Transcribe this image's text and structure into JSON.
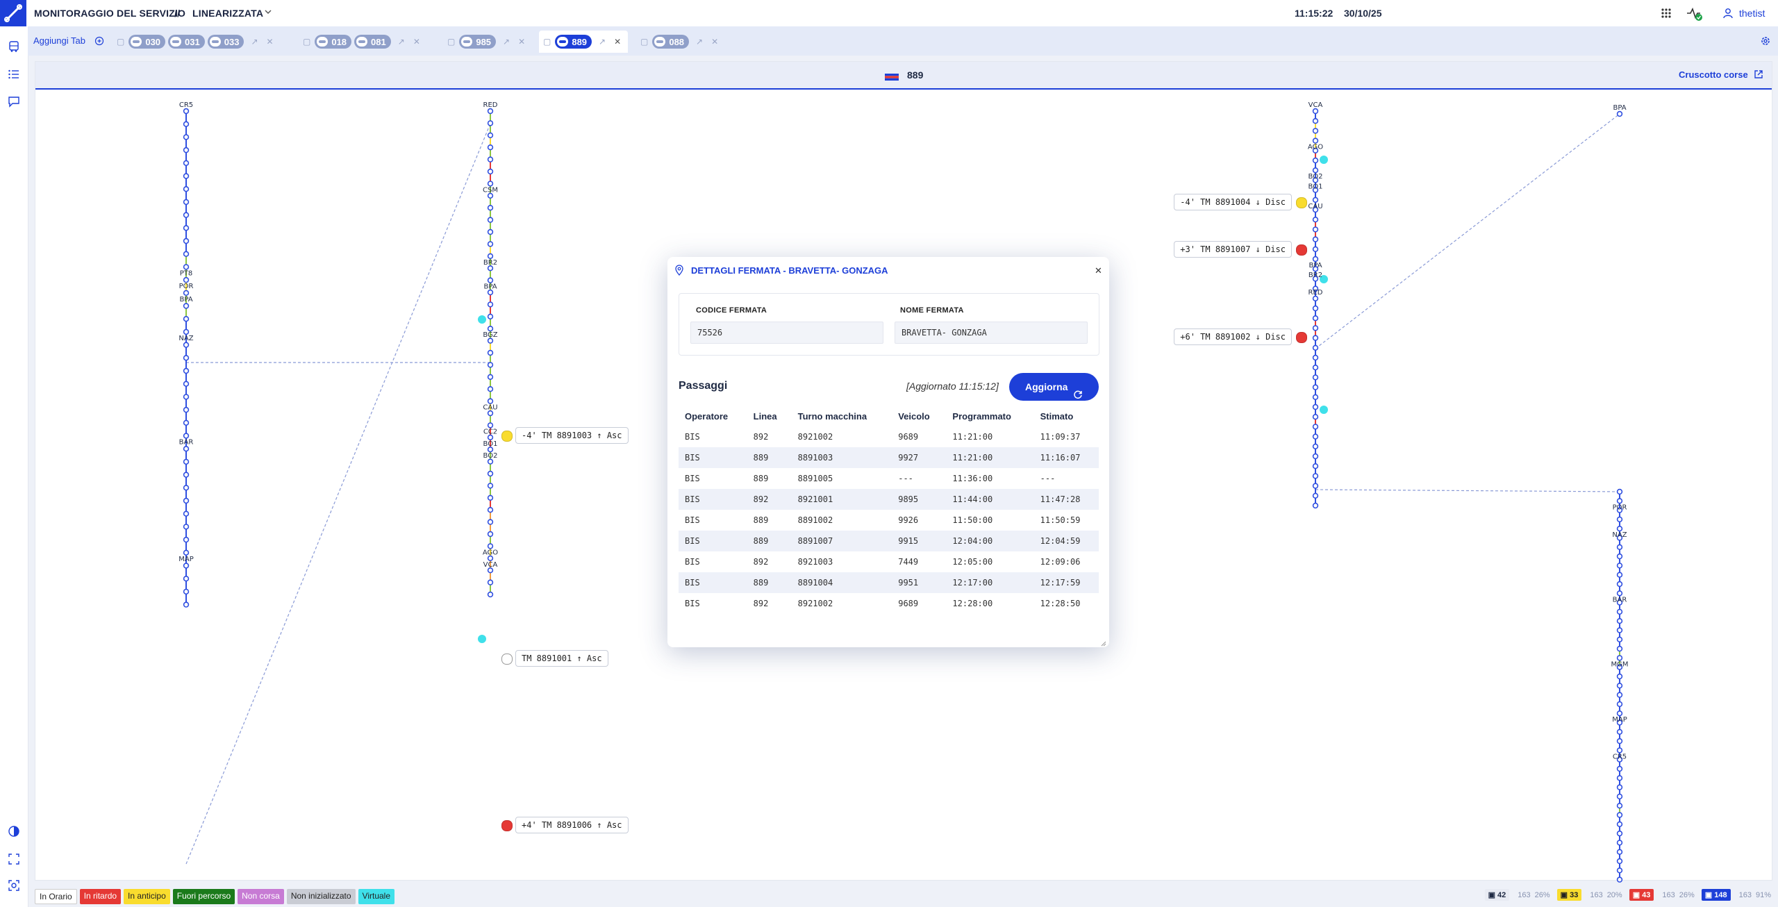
{
  "header": {
    "app_title": "MONITORAGGIO DEL SERVIZIO",
    "separator": "//",
    "view": "LINEARIZZATA",
    "time": "11:15:22",
    "date": "30/10/25",
    "user": "thetist"
  },
  "tabs": {
    "add_label": "Aggiungi Tab",
    "groups": [
      {
        "lines": [
          "030",
          "031",
          "033"
        ],
        "active": false
      },
      {
        "lines": [
          "018",
          "081"
        ],
        "active": false
      },
      {
        "lines": [
          "985"
        ],
        "active": false
      },
      {
        "lines": [
          "889"
        ],
        "active": true
      },
      {
        "lines": [
          "088"
        ],
        "active": false
      }
    ]
  },
  "panel": {
    "line": "889",
    "link_label": "Cruscotto corse"
  },
  "diagram": {
    "lines": [
      {
        "stops": [
          "CR5",
          "PT8",
          "POR",
          "BPA",
          "NAZ",
          "BAR",
          "MAP"
        ]
      },
      {
        "stops": [
          "RED",
          "CSM",
          "BR2",
          "BPA",
          "BGZ",
          "CAU",
          "CC2",
          "BO1",
          "BO2",
          "AGO",
          "VCA"
        ]
      },
      {
        "stops": [
          "VCA",
          "AGO",
          "BO2",
          "BO1",
          "CAU",
          "BPA",
          "BR2",
          "RED"
        ]
      },
      {
        "stops": [
          "BPA",
          "POR",
          "NAZ",
          "BAR",
          "MAP",
          "MGM",
          "CR5"
        ]
      }
    ],
    "vehicles": [
      {
        "text": "-4' TM 8891003 ↑ Asc",
        "status": "anticipo"
      },
      {
        "text": "TM 8891001 ↑ Asc",
        "status": "non-inizializzato"
      },
      {
        "text": "+4' TM 8891006 ↑ Asc",
        "status": "ritardo"
      },
      {
        "text": "-4' TM 8891004 ↓ Disc",
        "status": "anticipo"
      },
      {
        "text": "+3' TM 8891007 ↓ Disc",
        "status": "ritardo"
      },
      {
        "text": "+6' TM 8891002 ↓ Disc",
        "status": "ritardo"
      }
    ]
  },
  "dialog": {
    "title": "DETTAGLI FERMATA - BRAVETTA- GONZAGA",
    "code_label": "CODICE FERMATA",
    "code_value": "75526",
    "name_label": "NOME FERMATA",
    "name_value": "BRAVETTA- GONZAGA",
    "section": "Passaggi",
    "updated": "[Aggiornato 11:15:12]",
    "refresh_label": "Aggiorna",
    "columns": [
      "Operatore",
      "Linea",
      "Turno macchina",
      "Veicolo",
      "Programmato",
      "Stimato"
    ],
    "rows": [
      [
        "BIS",
        "892",
        "8921002",
        "9689",
        "11:21:00",
        "11:09:37"
      ],
      [
        "BIS",
        "889",
        "8891003",
        "9927",
        "11:21:00",
        "11:16:07"
      ],
      [
        "BIS",
        "889",
        "8891005",
        "---",
        "11:36:00",
        "---"
      ],
      [
        "BIS",
        "892",
        "8921001",
        "9895",
        "11:44:00",
        "11:47:28"
      ],
      [
        "BIS",
        "889",
        "8891002",
        "9926",
        "11:50:00",
        "11:50:59"
      ],
      [
        "BIS",
        "889",
        "8891007",
        "9915",
        "12:04:00",
        "12:04:59"
      ],
      [
        "BIS",
        "892",
        "8921003",
        "7449",
        "12:05:00",
        "12:09:06"
      ],
      [
        "BIS",
        "889",
        "8891004",
        "9951",
        "12:17:00",
        "12:17:59"
      ],
      [
        "BIS",
        "892",
        "8921002",
        "9689",
        "12:28:00",
        "12:28:50"
      ]
    ]
  },
  "legend": [
    {
      "label": "In Orario",
      "bg": "#ffffff",
      "fg": "#222222"
    },
    {
      "label": "In ritardo",
      "bg": "#e53935",
      "fg": "#ffffff"
    },
    {
      "label": "In anticipo",
      "bg": "#f9dc2e",
      "fg": "#222222"
    },
    {
      "label": "Fuori percorso",
      "bg": "#1b7a1b",
      "fg": "#ffffff"
    },
    {
      "label": "Non corsa",
      "bg": "#c77bd4",
      "fg": "#ffffff"
    },
    {
      "label": "Non inizializzato",
      "bg": "#c9ccd4",
      "fg": "#222222"
    },
    {
      "label": "Virtuale",
      "bg": "#3fe0ea",
      "fg": "#222222"
    }
  ],
  "stats": [
    {
      "count": "42",
      "a": "163",
      "b": "26%",
      "bg": "#e8ebf3",
      "fg": "#1f2a44"
    },
    {
      "count": "33",
      "a": "163",
      "b": "20%",
      "bg": "#f9dc2e",
      "fg": "#222222"
    },
    {
      "count": "43",
      "a": "163",
      "b": "26%",
      "bg": "#e53935",
      "fg": "#ffffff"
    },
    {
      "count": "148",
      "a": "163",
      "b": "91%",
      "bg": "#1d3fd8",
      "fg": "#ffffff"
    }
  ],
  "colors": {
    "primary": "#1d3fd8",
    "on_time": "#8cc63f",
    "late": "#e53935",
    "early": "#f9dc2e",
    "virtual": "#3fe0ea",
    "orange": "#f39c3d"
  },
  "icons": [
    "route-logo-icon",
    "chevron-down-icon",
    "apps-grid-icon",
    "activity-icon",
    "user-icon",
    "bus-icon",
    "list-icon",
    "chat-icon",
    "contrast-icon",
    "fullscreen-icon",
    "focus-icon",
    "settings-icon",
    "folder-icon",
    "open-external-icon",
    "close-icon",
    "refresh-icon",
    "pin-icon"
  ]
}
